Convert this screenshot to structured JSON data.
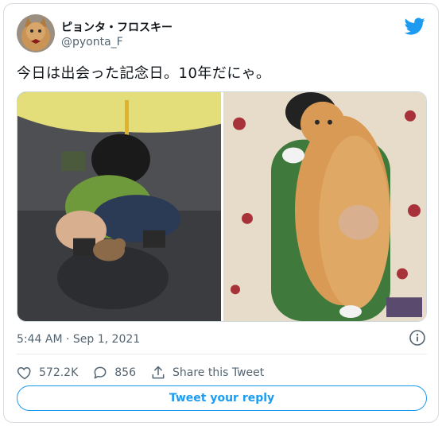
{
  "author": {
    "display_name": "ピョンタ・フロスキー",
    "handle": "@pyonta_F"
  },
  "tweet": {
    "text": "今日は出会った記念日。10年だにゃ。",
    "timestamp": "5:44 AM · Sep 1, 2021"
  },
  "stats": {
    "likes": "572.2K",
    "replies": "856",
    "share_label": "Share this Tweet"
  },
  "reply_button": {
    "label": "Tweet your reply"
  },
  "colors": {
    "accent": "#1d9bf0",
    "muted_text": "#536471",
    "border": "#d5dbe0"
  },
  "icons": [
    "twitter-bird-icon",
    "info-icon",
    "heart-icon",
    "reply-bubble-icon",
    "share-icon"
  ]
}
